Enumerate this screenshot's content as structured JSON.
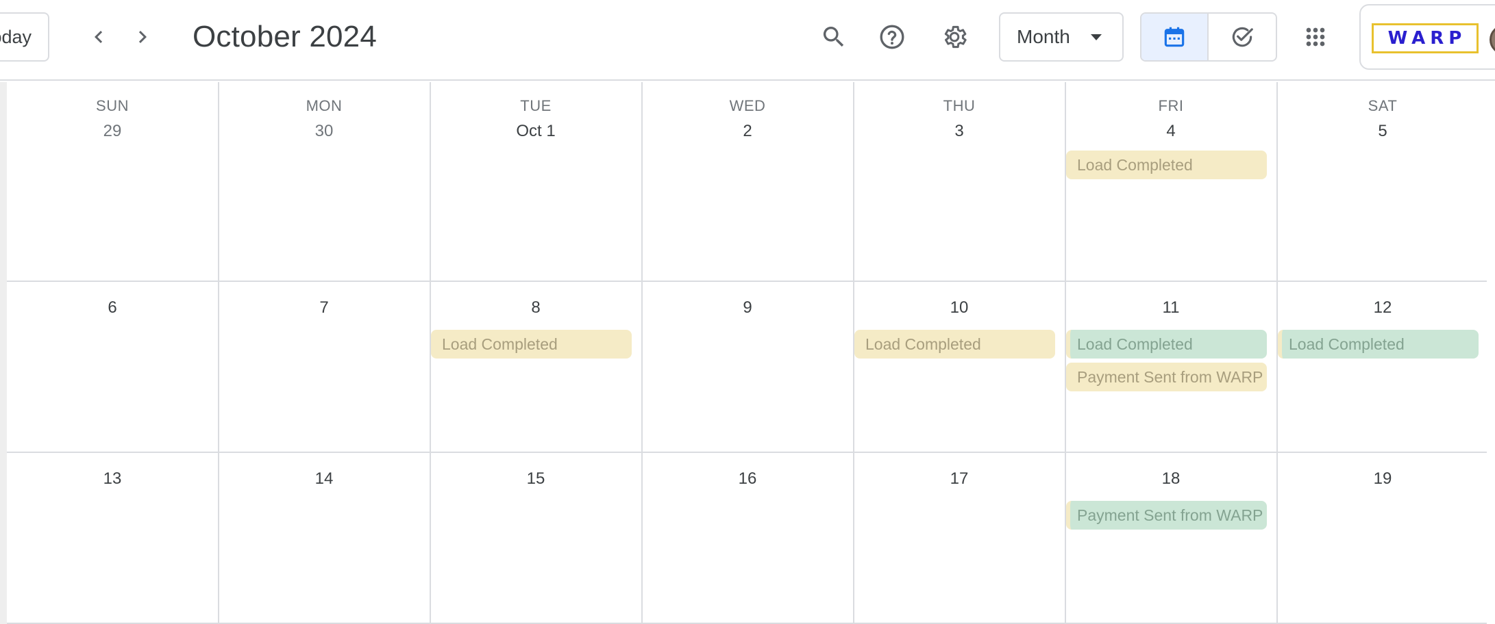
{
  "header": {
    "today_label": "Today",
    "month_title": "October 2024",
    "view_selector": "Month",
    "brand_logo_text": "WARP",
    "icons": {
      "prev": "chevron-left-icon",
      "next": "chevron-right-icon",
      "search": "search-icon",
      "help": "help-icon",
      "settings": "gear-icon",
      "calendar": "calendar-icon",
      "tasks": "check-circle-icon",
      "apps": "apps-grid-icon"
    }
  },
  "colors": {
    "event_yellow_bg": "#f5ebc6",
    "event_green_bg": "#cbe6d6",
    "toggle_active_bg": "#e8f0fe",
    "brand_blue": "#2a1fcf",
    "brand_gold": "#e8c12e"
  },
  "weekdays": [
    "SUN",
    "MON",
    "TUE",
    "WED",
    "THU",
    "FRI",
    "SAT"
  ],
  "weeks": [
    [
      "29",
      "30",
      "Oct 1",
      "2",
      "3",
      "4",
      "5"
    ],
    [
      "6",
      "7",
      "8",
      "9",
      "10",
      "11",
      "12"
    ],
    [
      "13",
      "14",
      "15",
      "16",
      "17",
      "18",
      "19"
    ]
  ],
  "events": [
    {
      "week": 0,
      "day": 5,
      "slot": 0,
      "title": "Load Completed",
      "color": "yellow"
    },
    {
      "week": 1,
      "day": 2,
      "slot": 0,
      "title": "Load Completed",
      "color": "yellow"
    },
    {
      "week": 1,
      "day": 4,
      "slot": 0,
      "title": "Load Completed",
      "color": "yellow"
    },
    {
      "week": 1,
      "day": 5,
      "slot": 0,
      "title": "Load Completed",
      "color": "green"
    },
    {
      "week": 1,
      "day": 5,
      "slot": 1,
      "title": "Payment Sent from WARP",
      "color": "yellow"
    },
    {
      "week": 1,
      "day": 6,
      "slot": 0,
      "title": "Load Completed",
      "color": "green"
    },
    {
      "week": 2,
      "day": 5,
      "slot": 0,
      "title": "Payment Sent from WARP",
      "color": "green"
    }
  ]
}
